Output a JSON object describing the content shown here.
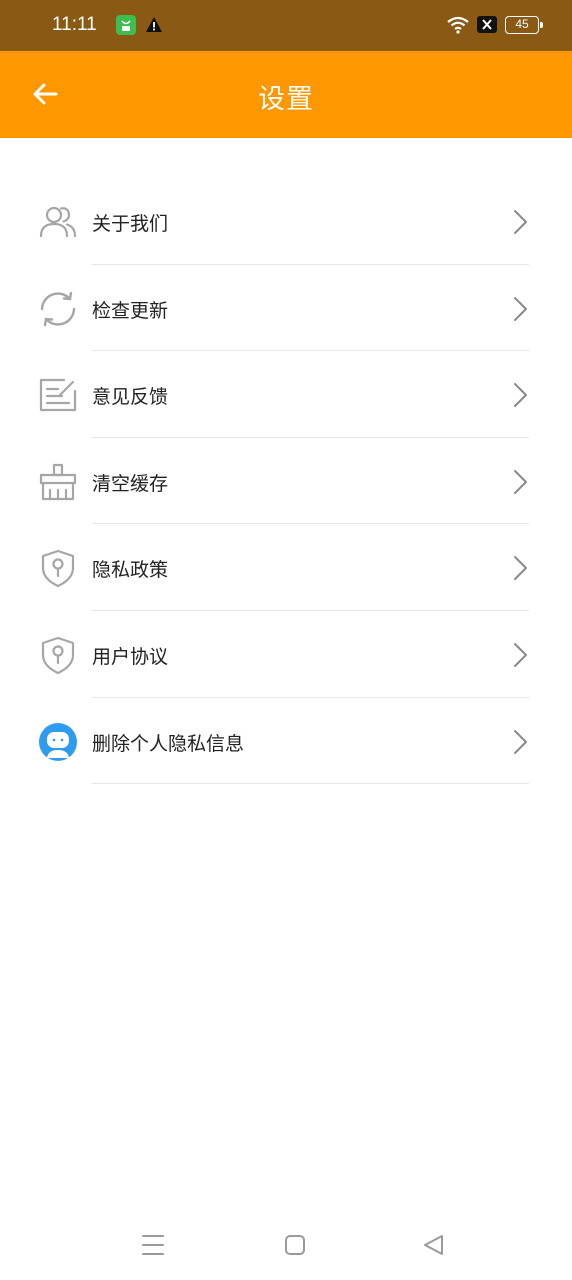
{
  "status_bar": {
    "time": "11:11",
    "battery_level": "45",
    "icons": [
      "app-notification-icon",
      "warning-icon",
      "wifi-icon",
      "mute-icon",
      "battery-icon"
    ]
  },
  "header": {
    "title": "设置",
    "back_icon": "back-arrow-icon",
    "background_color": "#ff9800"
  },
  "settings": {
    "items": [
      {
        "label": "关于我们",
        "icon": "users-icon"
      },
      {
        "label": "检查更新",
        "icon": "refresh-icon"
      },
      {
        "label": "意见反馈",
        "icon": "feedback-icon"
      },
      {
        "label": "清空缓存",
        "icon": "broom-icon"
      },
      {
        "label": "隐私政策",
        "icon": "privacy-shield-icon"
      },
      {
        "label": "用户协议",
        "icon": "agreement-shield-icon"
      },
      {
        "label": "删除个人隐私信息",
        "icon": "robot-avatar-icon"
      }
    ]
  },
  "nav_bar": {
    "buttons": [
      "menu-icon",
      "home-icon",
      "back-triangle-icon"
    ]
  },
  "colors": {
    "status_bar": "#8a5a14",
    "accent": "#ff9800",
    "icon_gray": "#a6a6a6",
    "avatar_blue": "#2d9cf0"
  }
}
